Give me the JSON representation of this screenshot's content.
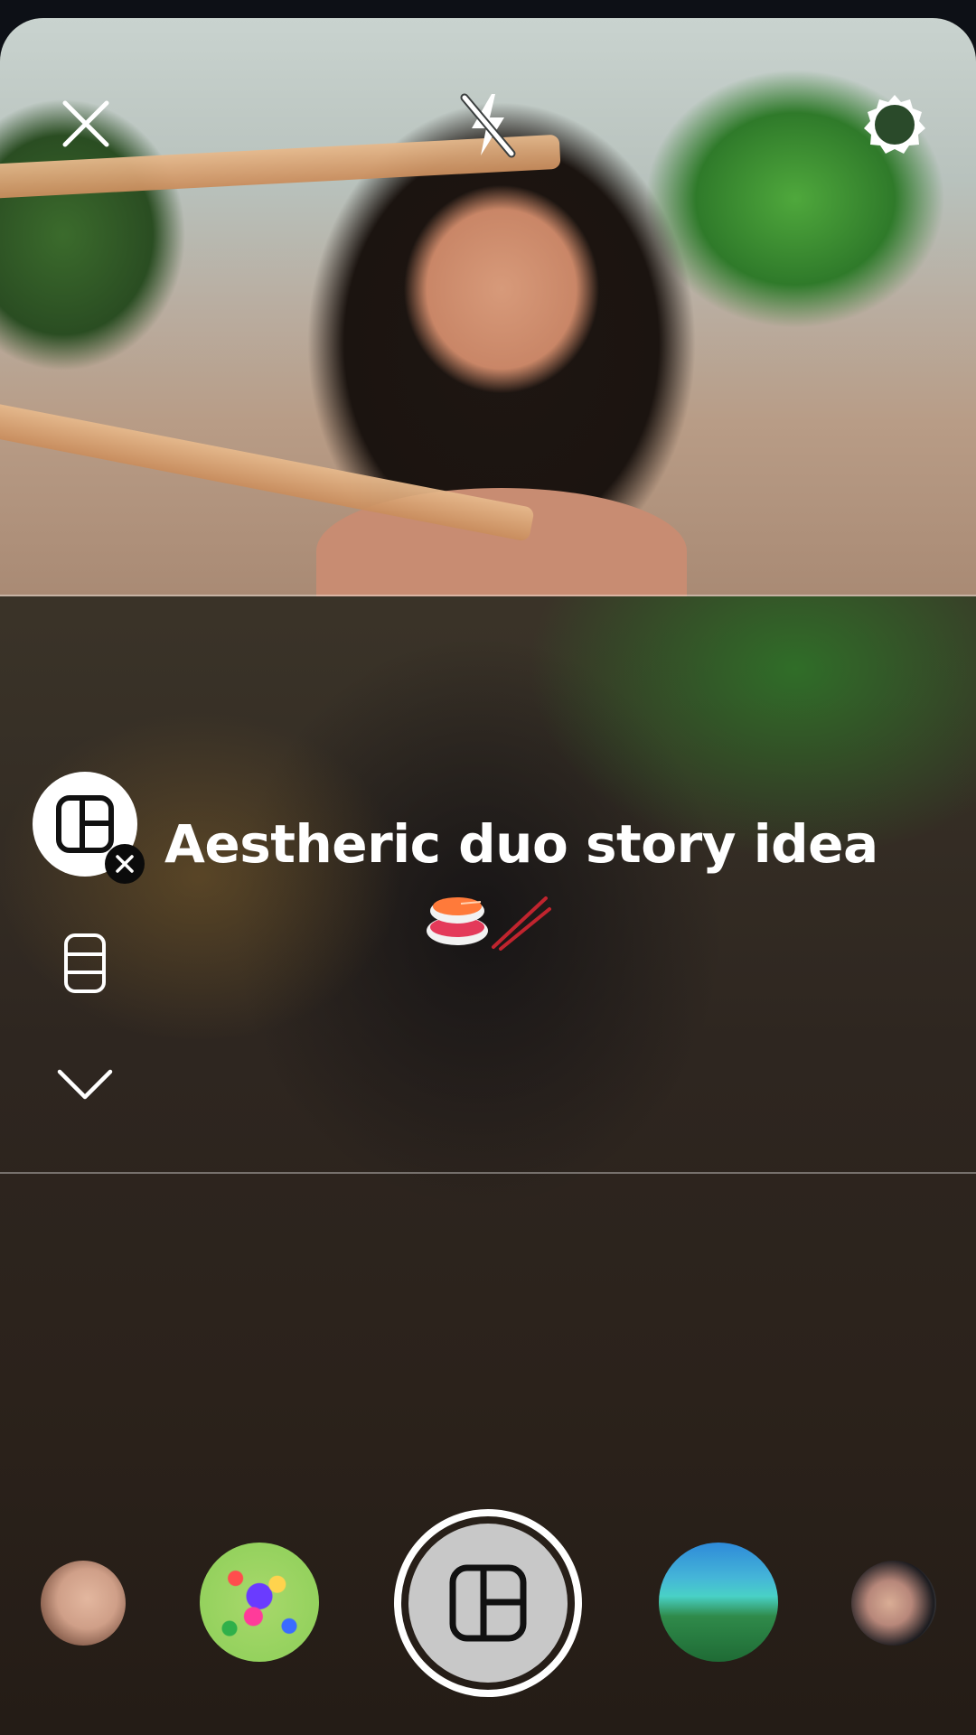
{
  "story": {
    "title": "Aestheric duo story idea",
    "emoji": [
      "sushi",
      "chopsticks"
    ]
  },
  "top_bar": {
    "icons": [
      "close-icon",
      "flash-off-icon",
      "settings-icon"
    ]
  },
  "side_tools": [
    "layout-icon",
    "grid-icon",
    "chevron-down-icon"
  ],
  "carousel": {
    "items": [
      "face-filter-1",
      "rainbow-sticker-filter",
      "tropical-beach-filter",
      "face-filter-2"
    ],
    "selected": "layout-capture"
  },
  "colors": {
    "text": "#ffffff",
    "shutter_ring": "#ffffff",
    "shutter_core": "#c8c8c8",
    "badge": "#0b0b0b"
  }
}
